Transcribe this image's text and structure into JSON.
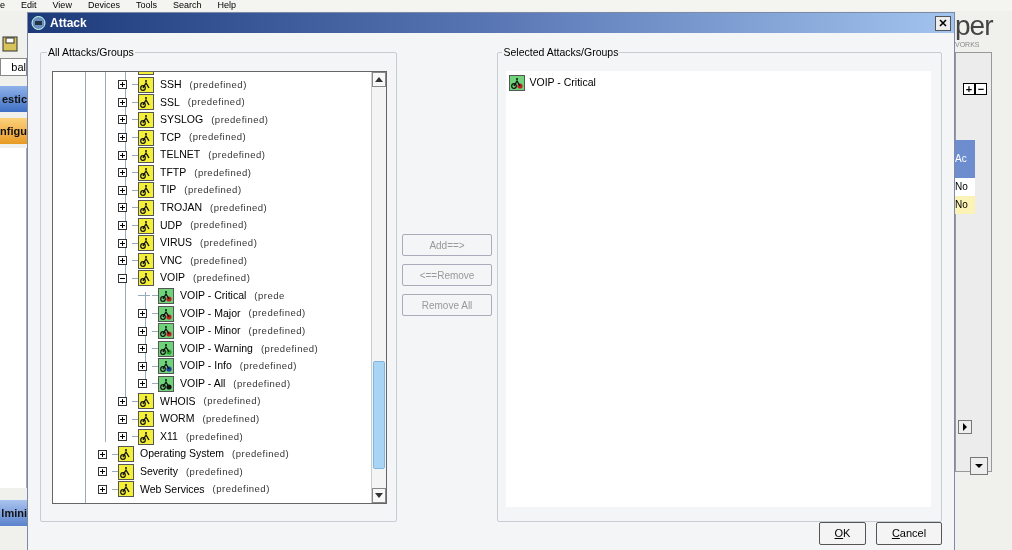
{
  "background_app": {
    "menu": [
      {
        "label": "e"
      },
      {
        "label": "Edit"
      },
      {
        "label": "View"
      },
      {
        "label": "Devices"
      },
      {
        "label": "Tools"
      },
      {
        "label": "Search"
      },
      {
        "label": "Help"
      }
    ],
    "left_fragments": [
      {
        "kind": "field",
        "text": "bal"
      },
      {
        "kind": "blue-tab",
        "text": "estic"
      },
      {
        "kind": "orange-tab",
        "text": "nfigu"
      },
      {
        "kind": "blue-tab-bottom",
        "text": "lmini"
      }
    ],
    "logo": {
      "text": "per",
      "subtext": "VORKS"
    },
    "tree_toolbar": [
      {
        "label": "+"
      },
      {
        "label": "−"
      }
    ],
    "table_fragments": [
      {
        "kind": "header",
        "text": "Ac"
      },
      {
        "kind": "row",
        "text": "No",
        "selected": false
      },
      {
        "kind": "row",
        "text": "No",
        "selected": true
      }
    ]
  },
  "dialog": {
    "title": "Attack",
    "left_group": {
      "title": "All Attacks/Groups",
      "tree": [
        {
          "children": [
            {
              "label": "SSH",
              "note": "(predefined)",
              "kind": "group",
              "expanded": false
            },
            {
              "label": "SSL",
              "note": "(predefined)",
              "kind": "group",
              "expanded": false
            },
            {
              "label": "SYSLOG",
              "note": "(predefined)",
              "kind": "group",
              "expanded": false
            },
            {
              "label": "TCP",
              "note": "(predefined)",
              "kind": "group",
              "expanded": false
            },
            {
              "label": "TELNET",
              "note": "(predefined)",
              "kind": "group",
              "expanded": false
            },
            {
              "label": "TFTP",
              "note": "(predefined)",
              "kind": "group",
              "expanded": false
            },
            {
              "label": "TIP",
              "note": "(predefined)",
              "kind": "group",
              "expanded": false
            },
            {
              "label": "TROJAN",
              "note": "(predefined)",
              "kind": "group",
              "expanded": false
            },
            {
              "label": "UDP",
              "note": "(predefined)",
              "kind": "group",
              "expanded": false
            },
            {
              "label": "VIRUS",
              "note": "(predefined)",
              "kind": "group",
              "expanded": false
            },
            {
              "label": "VNC",
              "note": "(predefined)",
              "kind": "group",
              "expanded": false
            },
            {
              "label": "VOIP",
              "note": "(predefined)",
              "kind": "group",
              "expanded": true,
              "children": [
                {
                  "label": "VOIP - Critical",
                  "note": "(prede",
                  "kind": "attack",
                  "color": "#c02020"
                },
                {
                  "label": "VOIP - Major",
                  "note": "(predefined)",
                  "kind": "attack",
                  "expanded": false,
                  "color": "#c02020"
                },
                {
                  "label": "VOIP - Minor",
                  "note": "(predefined)",
                  "kind": "attack",
                  "expanded": false,
                  "color": "#c02020"
                },
                {
                  "label": "VOIP - Warning",
                  "note": "(predefined)",
                  "kind": "attack",
                  "expanded": false,
                  "color": "#2e9e2e"
                },
                {
                  "label": "VOIP - Info",
                  "note": "(predefined)",
                  "kind": "attack",
                  "expanded": false,
                  "color": "#1a3fa0"
                },
                {
                  "label": "VOIP - All",
                  "note": "(predefined)",
                  "kind": "attack",
                  "expanded": false,
                  "color": "#111111"
                }
              ]
            },
            {
              "label": "WHOIS",
              "note": "(predefined)",
              "kind": "group",
              "expanded": false
            },
            {
              "label": "WORM",
              "note": "(predefined)",
              "kind": "group",
              "expanded": false
            },
            {
              "label": "X11",
              "note": "(predefined)",
              "kind": "group",
              "expanded": false
            }
          ]
        },
        {
          "label": "Operating System",
          "note": "(predefined)",
          "kind": "group",
          "expanded": false
        },
        {
          "label": "Severity",
          "note": "(predefined)",
          "kind": "group",
          "expanded": false
        },
        {
          "label": "Web Services",
          "note": "(predefined)",
          "kind": "group",
          "expanded": false
        }
      ]
    },
    "actions": [
      {
        "label": "Add==>",
        "disabled": true
      },
      {
        "label": "<==Remove",
        "disabled": true
      },
      {
        "label": "Remove All",
        "disabled": true
      }
    ],
    "right_group": {
      "title": "Selected Attacks/Groups",
      "items": [
        {
          "label": "VOIP - Critical",
          "kind": "attack",
          "color": "#c02020"
        }
      ]
    },
    "buttons": [
      {
        "label": "OK",
        "mnemonic": true
      },
      {
        "label": "Cancel",
        "mnemonic": true
      }
    ]
  }
}
